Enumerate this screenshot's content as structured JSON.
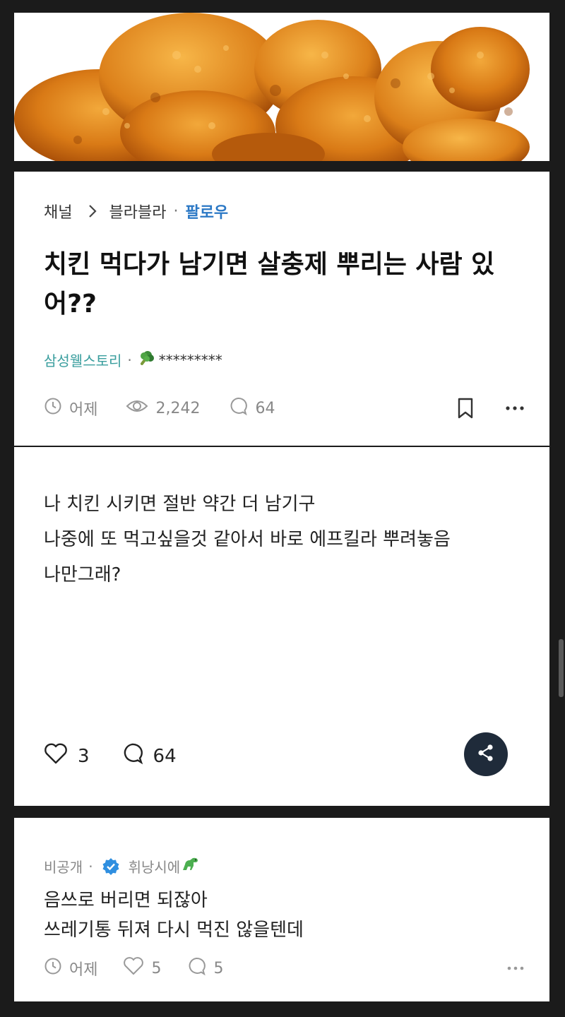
{
  "hero": {
    "image": "fried-chicken-photo"
  },
  "breadcrumb": {
    "channel": "채널",
    "board": "블라블라",
    "follow": "팔로우"
  },
  "post": {
    "title": "치킨 먹다가 남기면 살충제 뿌리는 사람 있어??",
    "author_company": "삼성웰스토리",
    "author_masked": "*********",
    "time": "어제",
    "views": "2,242",
    "comment_count": "64",
    "body_lines": [
      "나 치킨 시키면 절반 약간 더 남기구",
      "나중에 또 먹고싶을것 같아서 바로 에프킬라 뿌려놓음",
      "나만그래?"
    ],
    "likes": "3",
    "comments": "64"
  },
  "comment": {
    "visibility": "비공개",
    "nickname": "휘낭시에",
    "lines": [
      "음쓰로 버리면 되잖아",
      "쓰레기통 뒤져 다시 먹진 않을텐데"
    ],
    "time": "어제",
    "likes": "5",
    "replies": "5"
  },
  "colors": {
    "follow": "#2b78c5",
    "company": "#3a9e9e",
    "share_button": "#1f2b3a",
    "background": "#1b1b1b"
  }
}
